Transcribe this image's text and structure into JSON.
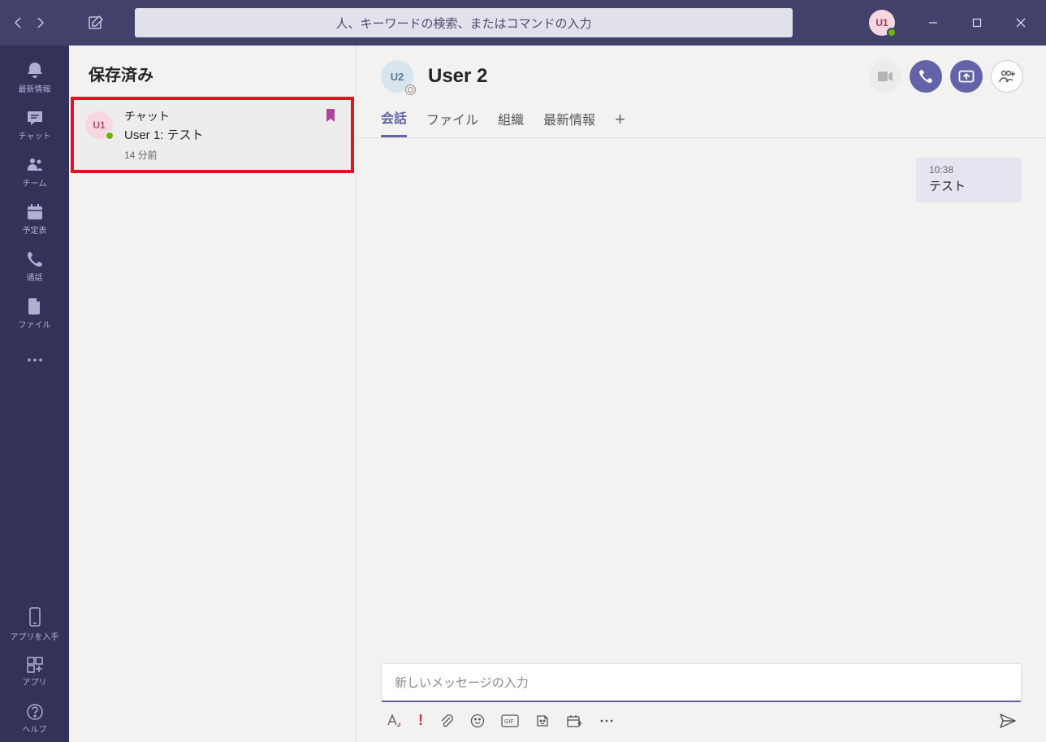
{
  "titlebar": {
    "search_placeholder": "人、キーワードの検索、またはコマンドの入力",
    "avatar_initials": "U1"
  },
  "rail": {
    "items": [
      {
        "label": "最新情報"
      },
      {
        "label": "チャット"
      },
      {
        "label": "チーム"
      },
      {
        "label": "予定表"
      },
      {
        "label": "通話"
      },
      {
        "label": "ファイル"
      }
    ],
    "bottom": [
      {
        "label": "アプリを入手"
      },
      {
        "label": "アプリ"
      },
      {
        "label": "ヘルプ"
      }
    ]
  },
  "panel": {
    "title": "保存済み",
    "items": [
      {
        "avatar": "U1",
        "title": "チャット",
        "preview": "User 1: テスト",
        "time": "14 分前"
      }
    ]
  },
  "chat": {
    "avatar": "U2",
    "name": "User 2",
    "tabs": [
      {
        "label": "会話",
        "active": true
      },
      {
        "label": "ファイル"
      },
      {
        "label": "組織"
      },
      {
        "label": "最新情報"
      }
    ],
    "messages": [
      {
        "time": "10:38",
        "text": "テスト"
      }
    ],
    "compose_placeholder": "新しいメッセージの入力"
  }
}
